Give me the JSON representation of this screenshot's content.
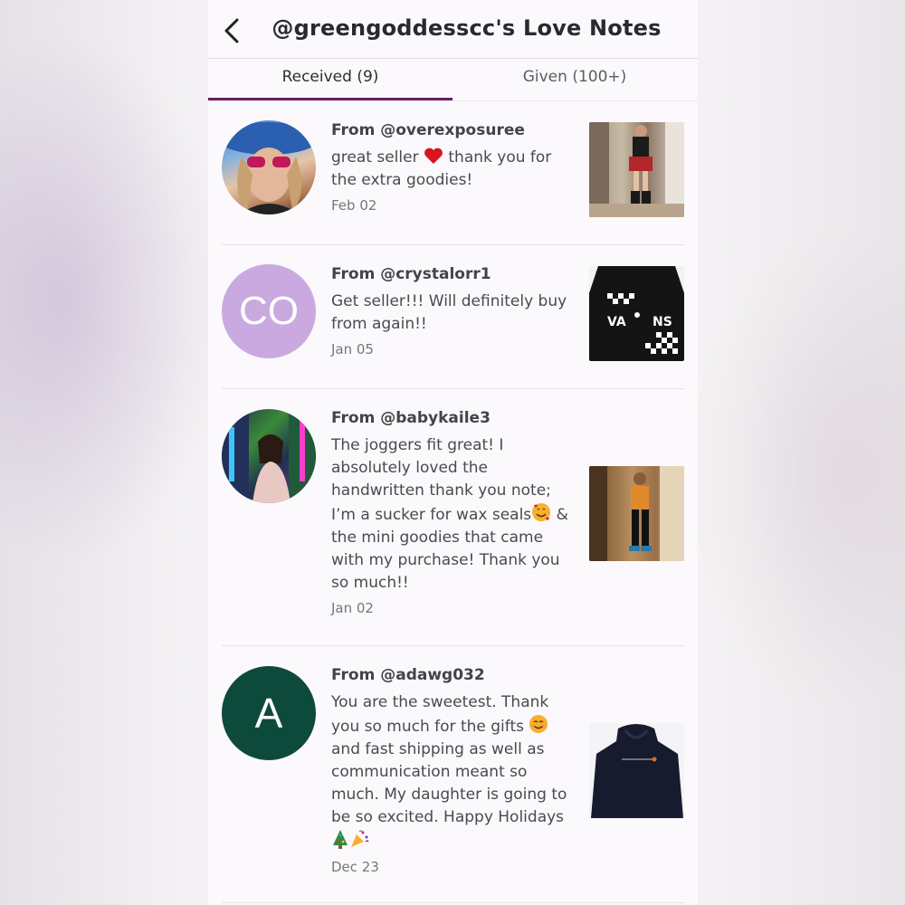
{
  "header": {
    "title": "@greengoddesscc's Love Notes",
    "back_icon": "chevron-left-icon"
  },
  "tabs": [
    {
      "label": "Received (9)",
      "active": true
    },
    {
      "label": "Given (100+)",
      "active": false
    }
  ],
  "notes": [
    {
      "from": "From @overexposuree",
      "message_parts": [
        "great seller",
        "thank you for the extra goodies!"
      ],
      "emoji": "red-heart",
      "date": "Feb 02",
      "avatar": "photo"
    },
    {
      "from": "From @crystalorr1",
      "message": "Get seller!!! Will definitely buy from again!!",
      "date": "Jan 05",
      "avatar_initials": "CO",
      "avatar_color": "#c9a9e0"
    },
    {
      "from": "From @babykaile3",
      "message_parts": [
        "The joggers fit great! I absolutely loved the handwritten thank you note; I’m a sucker for wax seals",
        "& the mini goodies that came with my purchase! Thank you so much!!"
      ],
      "emoji": "smiling-face-with-hearts",
      "date": "Jan 02",
      "avatar": "photo"
    },
    {
      "from": "From @adawg032",
      "message_parts": [
        "You are the sweetest. Thank you so much for the gifts",
        "and fast shipping as well as communication meant so much. My daughter is going to be so excited. Happy Holidays"
      ],
      "emojis": [
        "smiling-face",
        "christmas-tree",
        "party-popper"
      ],
      "date": "Dec 23",
      "avatar_initials": "A",
      "avatar_color": "#0e4a3b"
    }
  ]
}
